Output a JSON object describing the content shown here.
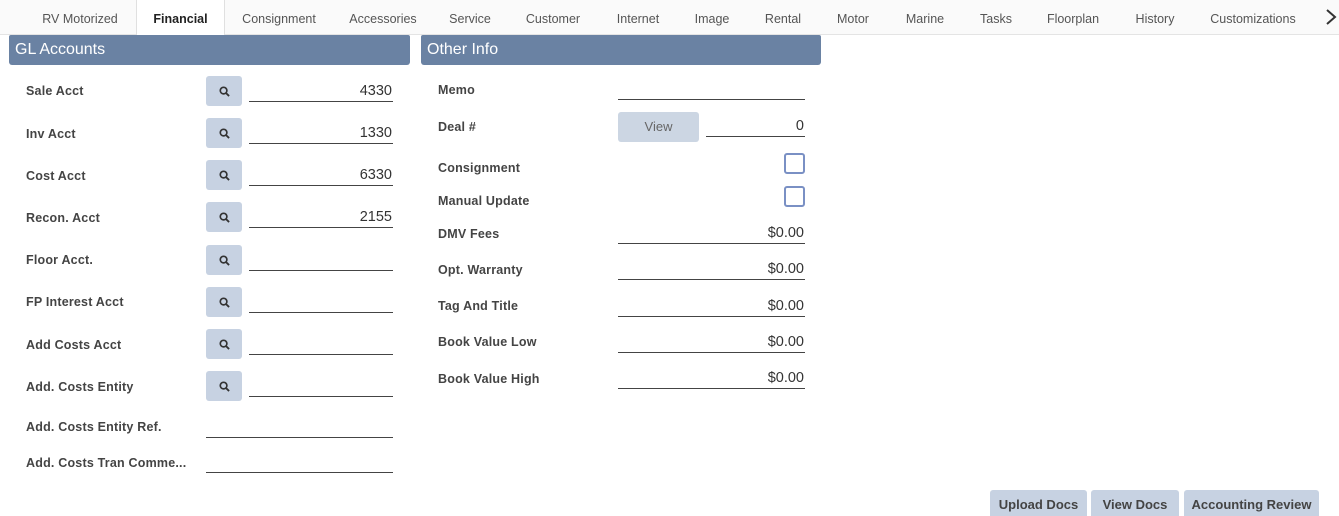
{
  "tabs": [
    {
      "label": "RV Motorized"
    },
    {
      "label": "Financial"
    },
    {
      "label": "Consignment"
    },
    {
      "label": "Accessories"
    },
    {
      "label": "Service"
    },
    {
      "label": "Customer"
    },
    {
      "label": "Internet"
    },
    {
      "label": "Image"
    },
    {
      "label": "Rental"
    },
    {
      "label": "Motor"
    },
    {
      "label": "Marine"
    },
    {
      "label": "Tasks"
    },
    {
      "label": "Floorplan"
    },
    {
      "label": "History"
    },
    {
      "label": "Customizations"
    }
  ],
  "active_tab": "Financial",
  "tab_scroll_icon": "chevron-right-icon",
  "gl_accounts": {
    "title": "GL Accounts",
    "rows": [
      {
        "label": "Sale Acct",
        "value": "4330"
      },
      {
        "label": "Inv Acct",
        "value": "1330"
      },
      {
        "label": "Cost Acct",
        "value": "6330"
      },
      {
        "label": "Recon. Acct",
        "value": "2155"
      },
      {
        "label": "Floor Acct.",
        "value": ""
      },
      {
        "label": "FP Interest Acct",
        "value": ""
      },
      {
        "label": "Add Costs Acct",
        "value": ""
      },
      {
        "label": "Add. Costs Entity",
        "value": ""
      },
      {
        "label": "Add. Costs Entity Ref.",
        "value": ""
      },
      {
        "label": "Add. Costs Tran Comme...",
        "value": ""
      }
    ]
  },
  "other_info": {
    "title": "Other Info",
    "memo": {
      "label": "Memo",
      "value": ""
    },
    "deal": {
      "label": "Deal #",
      "button": "View",
      "value": "0"
    },
    "consignment": {
      "label": "Consignment",
      "checked": false
    },
    "manual_update": {
      "label": "Manual Update",
      "checked": false
    },
    "dmv_fees": {
      "label": "DMV Fees",
      "value": "$0.00"
    },
    "opt_warranty": {
      "label": "Opt. Warranty",
      "value": "$0.00"
    },
    "tag_and_title": {
      "label": "Tag And Title",
      "value": "$0.00"
    },
    "book_value_low": {
      "label": "Book Value Low",
      "value": "$0.00"
    },
    "book_value_high": {
      "label": "Book Value High",
      "value": "$0.00"
    }
  },
  "footer": {
    "upload_docs": "Upload Docs",
    "view_docs": "View Docs",
    "accounting_review": "Accounting Review"
  },
  "colors": {
    "panel_header": "#6a82a3",
    "lookup_button": "#c7d2e2",
    "checkbox_border": "#7a90c4"
  }
}
